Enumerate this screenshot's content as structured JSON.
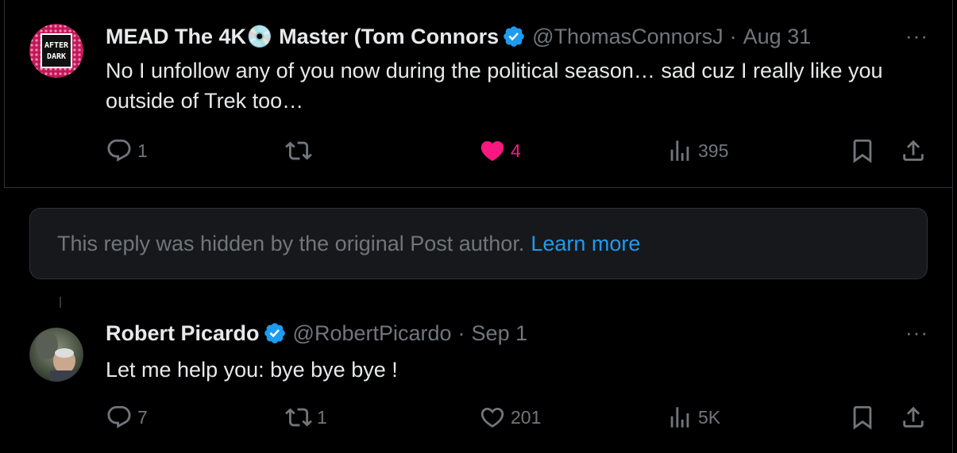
{
  "tweet1": {
    "name": "MEAD The 4K💿 Master (Tom Connors",
    "handle": "@ThomasConnorsJ",
    "separator": "·",
    "date": "Aug 31",
    "more": "···",
    "avatar_text": [
      "AFTER",
      "DARK"
    ],
    "text": "No I unfollow any of you now during the political season… sad cuz I really like you outside of Trek too…",
    "actions": {
      "replies": "1",
      "reposts": "",
      "likes": "4",
      "views": "395"
    },
    "liked": true
  },
  "hidden_reply": {
    "text": "This reply was hidden by the original Post author.",
    "link": "Learn more"
  },
  "tweet2": {
    "name": "Robert Picardo",
    "handle": "@RobertPicardo",
    "separator": "·",
    "date": "Sep 1",
    "more": "···",
    "text": "Let me help you: bye bye bye !",
    "actions": {
      "replies": "7",
      "reposts": "1",
      "likes": "201",
      "views": "5K"
    },
    "liked": false
  },
  "colors": {
    "background": "#000000",
    "text": "#e7e9ea",
    "muted": "#71767b",
    "link": "#1d9bf0",
    "like_active": "#f91880",
    "verified": "#1d9bf0"
  }
}
